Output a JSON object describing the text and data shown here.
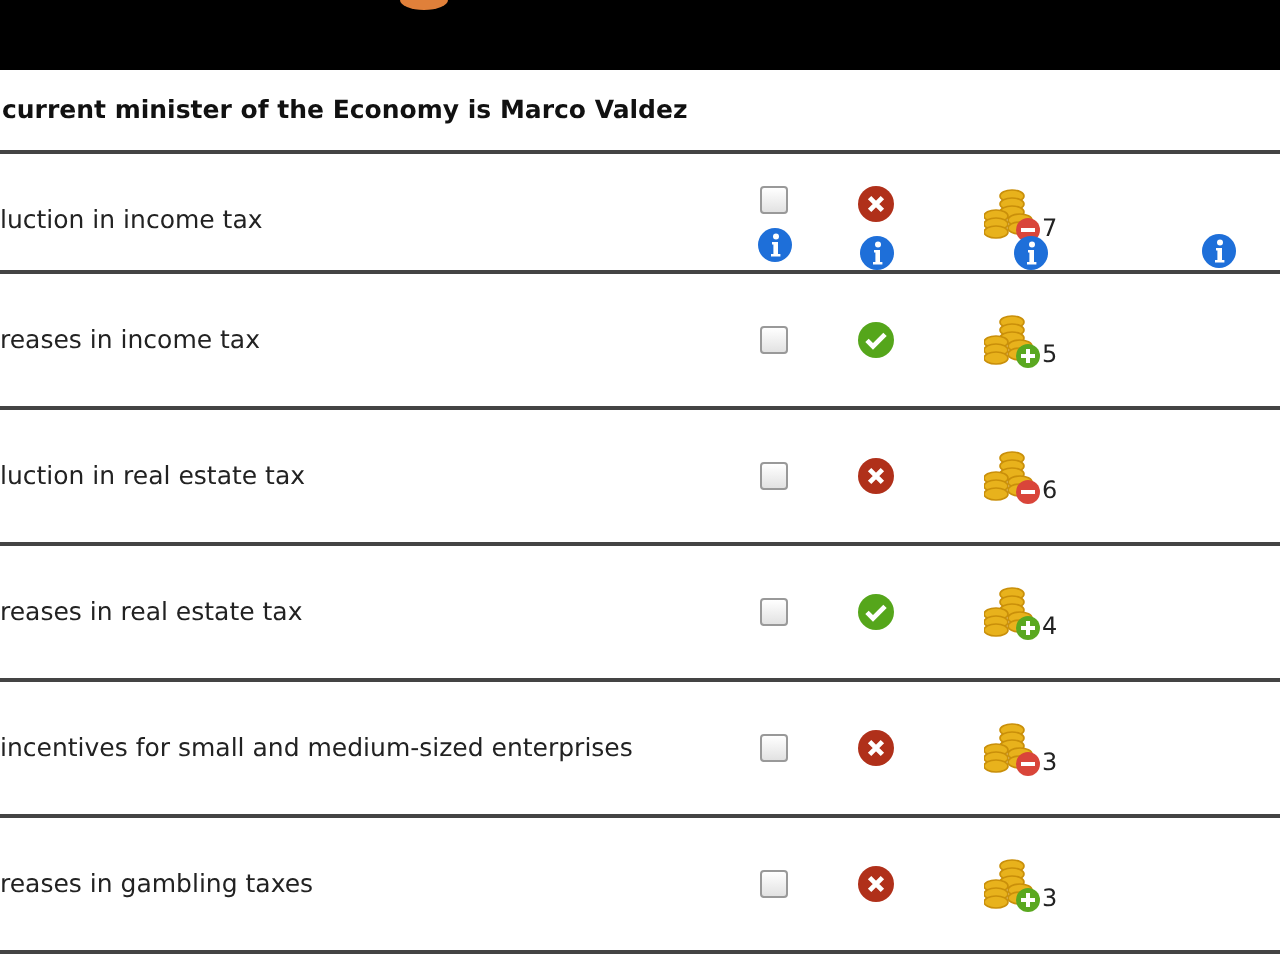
{
  "heading": "current minister of the Economy is Marco Valdez",
  "rows": [
    {
      "label": "luction in income tax",
      "checked": false,
      "approved": false,
      "kind": "decrease",
      "cost": "7",
      "info": true
    },
    {
      "label": "reases in income tax",
      "checked": false,
      "approved": true,
      "kind": "increase",
      "cost": "5",
      "info": false
    },
    {
      "label": "luction in real estate tax",
      "checked": false,
      "approved": false,
      "kind": "decrease",
      "cost": "6",
      "info": false
    },
    {
      "label": "reases in real estate tax",
      "checked": false,
      "approved": true,
      "kind": "increase",
      "cost": "4",
      "info": false
    },
    {
      "label": "incentives for small and medium-sized enterprises",
      "checked": false,
      "approved": false,
      "kind": "decrease",
      "cost": "3",
      "info": false
    },
    {
      "label": "reases in gambling taxes",
      "checked": false,
      "approved": false,
      "kind": "increase",
      "cost": "3",
      "info": false
    }
  ]
}
